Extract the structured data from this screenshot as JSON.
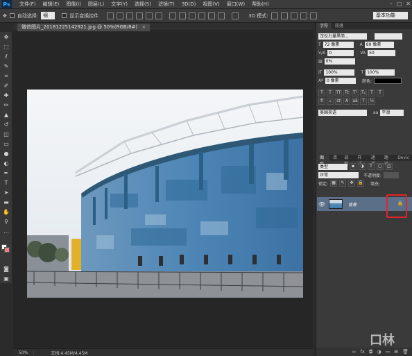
{
  "menubar": {
    "logo": "Ps",
    "items": [
      "文件(F)",
      "编辑(E)",
      "图像(I)",
      "图层(L)",
      "文字(Y)",
      "选择(S)",
      "滤镜(T)",
      "3D(D)",
      "视图(V)",
      "窗口(W)",
      "帮助(H)"
    ]
  },
  "optionsbar": {
    "auto_select_label": "自动选择:",
    "auto_select_value": "组",
    "show_transform_label": "显示变换控件",
    "mode_3d_label": "3D 模式:",
    "workspace": "基本功能"
  },
  "document": {
    "tab_title": "微信图片_20181225142921.jpg @ 50%(RGB/8#)",
    "zoom": "50%",
    "doc_info": "文档:4.45M/4.45M"
  },
  "character_panel": {
    "tabs": [
      "字符",
      "段落"
    ],
    "font_family": "汉仪力量黑简...",
    "font_size": "72 像素",
    "leading": "89 像素",
    "kerning": "0",
    "tracking": "50",
    "scale_percent": "0%",
    "vertical_scale": "100%",
    "horizontal_scale": "100%",
    "baseline_shift": "0 像素",
    "color_label": "颜色:",
    "color_value": "#000000",
    "language": "美国英语",
    "aa_label": "aa",
    "aa_value": "平滑"
  },
  "layers_panel": {
    "tabs": [
      "图层",
      "库",
      "调整",
      "样式",
      "通道",
      "路径",
      "Devic"
    ],
    "filter_kind": "类型",
    "blend_mode": "正常",
    "opacity_label": "不透明度:",
    "lock_label": "锁定:",
    "fill_label": "填充:",
    "layer_name": "背景"
  },
  "watermark": "口林"
}
